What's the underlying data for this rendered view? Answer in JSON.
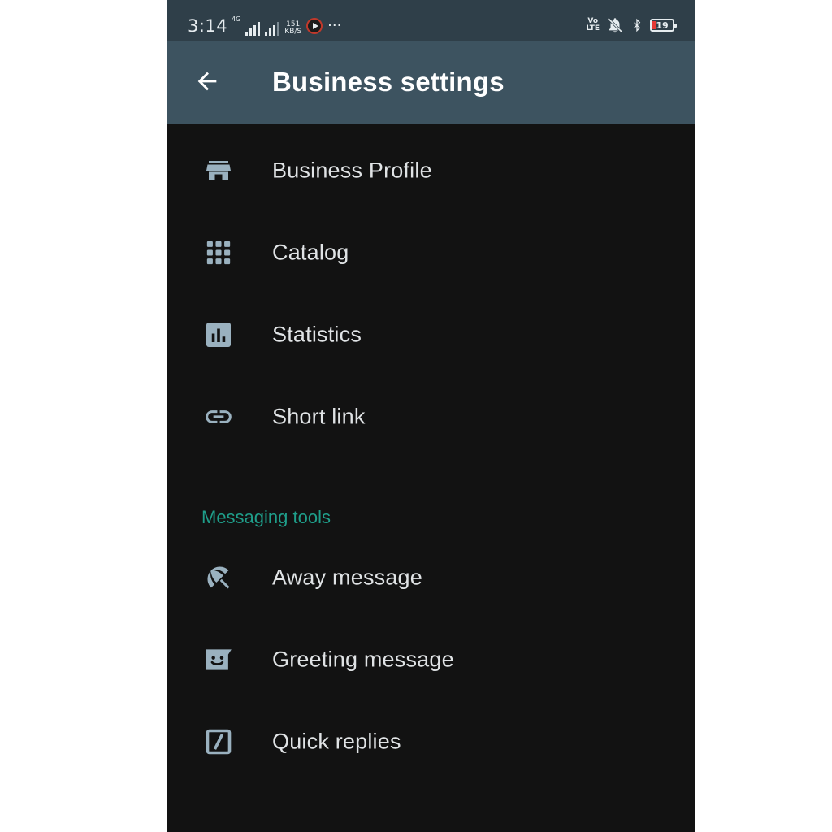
{
  "status_bar": {
    "time": "3:14",
    "network_label": "4G",
    "speed_value": "151",
    "speed_unit": "KB/S",
    "more": "···",
    "volte_top": "Vo",
    "volte_bottom": "LTE",
    "battery": "19"
  },
  "header": {
    "title": "Business settings",
    "back_icon": "arrow-left-icon"
  },
  "menu": {
    "items": [
      {
        "label": "Business Profile",
        "icon": "storefront-icon"
      },
      {
        "label": "Catalog",
        "icon": "grid-dots-icon"
      },
      {
        "label": "Statistics",
        "icon": "bar-chart-icon"
      },
      {
        "label": "Short link",
        "icon": "link-icon"
      }
    ]
  },
  "messaging_tools": {
    "section_title": "Messaging tools",
    "items": [
      {
        "label": "Away message",
        "icon": "umbrella-icon"
      },
      {
        "label": "Greeting message",
        "icon": "greeting-icon"
      },
      {
        "label": "Quick replies",
        "icon": "quick-reply-icon"
      }
    ]
  },
  "colors": {
    "status_bar_bg": "#2f3f49",
    "app_bar_bg": "#3d5360",
    "page_bg": "#121212",
    "icon": "#9ab1bf",
    "accent": "#1f9e8a",
    "text": "#e0e3e5"
  }
}
